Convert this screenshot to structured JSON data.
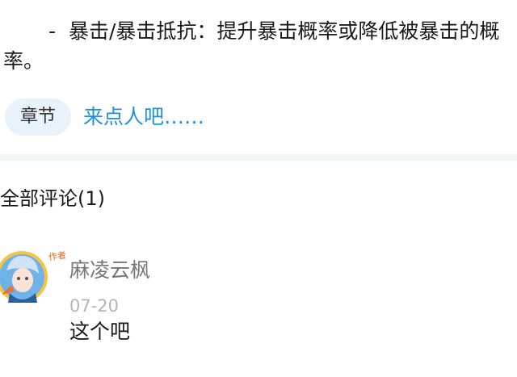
{
  "article": {
    "paragraph_indent": "-",
    "paragraph": "暴击/暴击抵抗：提升暴击概率或降低被暴击的概率。"
  },
  "chapter": {
    "tag": "章节",
    "link": "来点人吧……"
  },
  "comments": {
    "title": "全部评论(1)",
    "items": [
      {
        "author": "麻凌云枫",
        "badge": "作者",
        "date": "07-20",
        "text": "这个吧"
      }
    ]
  },
  "colors": {
    "link": "#1f8fe0",
    "tag_bg": "#e7f2fb",
    "divider": "#f3f4f5",
    "muted": "#777777"
  }
}
